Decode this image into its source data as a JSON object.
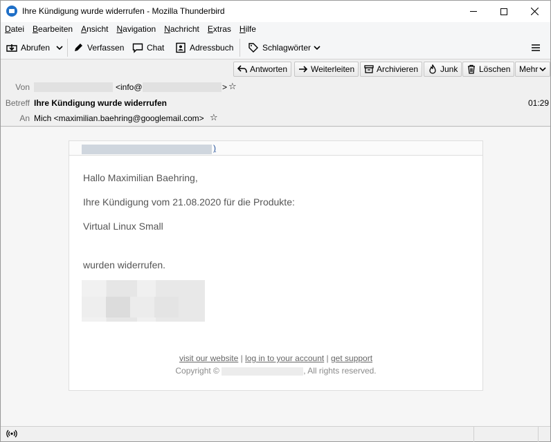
{
  "window": {
    "title": "Ihre Kündigung wurde widerrufen - Mozilla Thunderbird"
  },
  "menubar": {
    "items": [
      {
        "label": "Datei",
        "accel": "D",
        "rest": "atei"
      },
      {
        "label": "Bearbeiten",
        "accel": "B",
        "rest": "earbeiten"
      },
      {
        "label": "Ansicht",
        "accel": "A",
        "rest": "nsicht"
      },
      {
        "label": "Navigation",
        "accel": "N",
        "rest": "avigation"
      },
      {
        "label": "Nachricht",
        "accel": "N",
        "rest": "achricht"
      },
      {
        "label": "Extras",
        "accel": "E",
        "rest": "xtras"
      },
      {
        "label": "Hilfe",
        "accel": "H",
        "rest": "ilfe"
      }
    ]
  },
  "toolbar": {
    "get_mail": "Abrufen",
    "compose": "Verfassen",
    "chat": "Chat",
    "address_book": "Adressbuch",
    "tags": "Schlagwörter"
  },
  "header_buttons": {
    "reply": "Antworten",
    "forward": "Weiterleiten",
    "archive": "Archivieren",
    "junk": "Junk",
    "delete": "Löschen",
    "more": "Mehr"
  },
  "message_header": {
    "from_label": "Von",
    "from_value_visible_start": "<info@",
    "from_value_visible_end": ">",
    "subject_label": "Betreff",
    "subject": "Ihre Kündigung wurde widerrufen",
    "time": "01:29",
    "to_label": "An",
    "to": "Mich <maximilian.baehring@googlemail.com>"
  },
  "message_body": {
    "greeting": "Hallo  Maximilian Baehring,",
    "line1": "Ihre Kündigung vom 21.08.2020 für die Produkte:",
    "product": "Virtual Linux Small",
    "line2": "wurden widerrufen.",
    "footer": {
      "link_website": "visit our website",
      "sep1": " | ",
      "link_login": "log in to your account",
      "sep2": " | ",
      "link_support": "get support",
      "copyright_prefix": "Copyright ©",
      "copyright_suffix": ", All rights reserved."
    }
  },
  "colors": {
    "accent": "#1f6fc7",
    "body_text": "#555555"
  }
}
